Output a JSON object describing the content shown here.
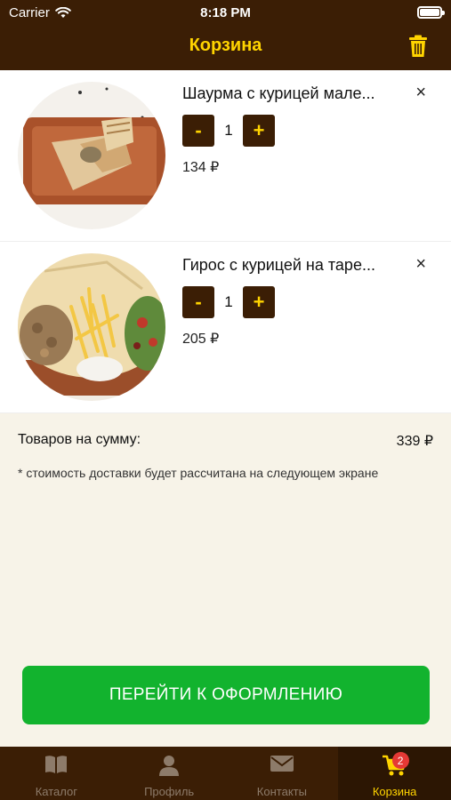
{
  "status_bar": {
    "carrier": "Carrier",
    "time": "8:18 PM"
  },
  "header": {
    "title": "Корзина"
  },
  "cart": {
    "items": [
      {
        "name": "Шаурма с курицей мале...",
        "quantity": "1",
        "price": "134 ₽",
        "minus_label": "-",
        "plus_label": "+",
        "remove_label": "×"
      },
      {
        "name": "Гирос с курицей на таре...",
        "quantity": "1",
        "price": "205 ₽",
        "minus_label": "-",
        "plus_label": "+",
        "remove_label": "×"
      }
    ]
  },
  "summary": {
    "label": "Товаров на сумму:",
    "total": "339 ₽",
    "note": "* стоимость доставки будет рассчитана на следующем экране"
  },
  "checkout_button": "ПЕРЕЙТИ К ОФОРМЛЕНИЮ",
  "tabbar": {
    "tabs": [
      {
        "label": "Каталог",
        "icon": "book-icon"
      },
      {
        "label": "Профиль",
        "icon": "person-icon"
      },
      {
        "label": "Контакты",
        "icon": "envelope-icon"
      },
      {
        "label": "Корзина",
        "icon": "cart-icon",
        "badge": "2",
        "active": true
      }
    ]
  },
  "colors": {
    "bar": "#3b1e05",
    "accent": "#ffd400",
    "checkout": "#12b32e",
    "background": "#f7f3e8",
    "badge": "#e53935"
  }
}
